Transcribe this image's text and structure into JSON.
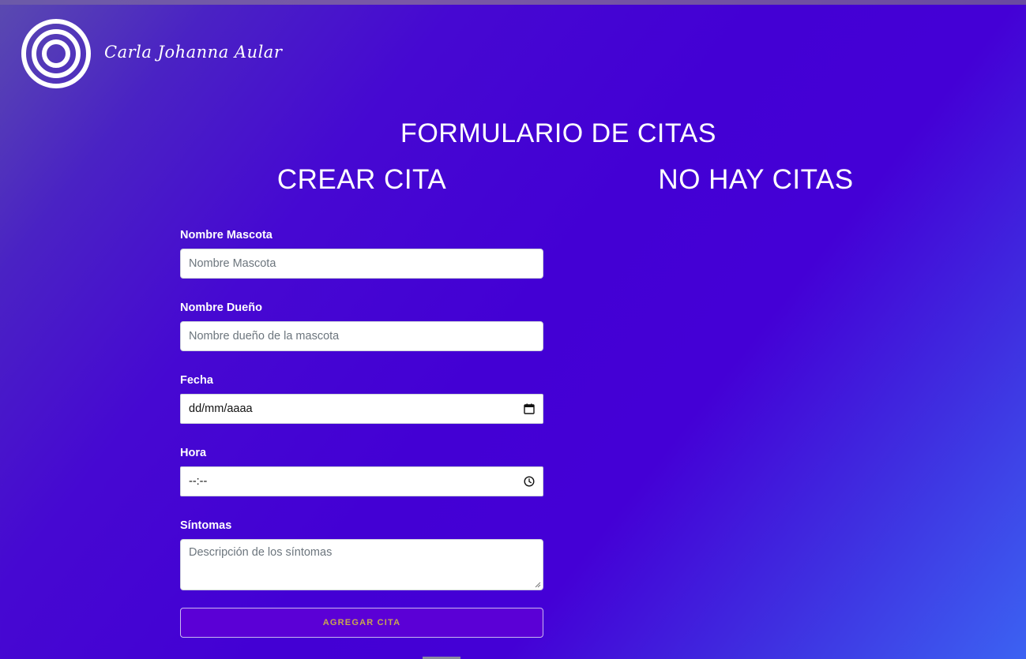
{
  "header": {
    "brand_name": "Carla Johanna Aular",
    "logo_icon": "concentric-circles-logo"
  },
  "page": {
    "title": "FORMULARIO DE CITAS",
    "create_heading": "CREAR CITA",
    "appointments_heading": "NO HAY CITAS"
  },
  "form": {
    "pet_name": {
      "label": "Nombre Mascota",
      "placeholder": "Nombre Mascota"
    },
    "owner_name": {
      "label": "Nombre Dueño",
      "placeholder": "Nombre dueño de la mascota"
    },
    "date": {
      "label": "Fecha",
      "value": "dd/mm/aaaa",
      "icon": "calendar-icon"
    },
    "time": {
      "label": "Hora",
      "value": "--:--",
      "icon": "clock-icon"
    },
    "symptoms": {
      "label": "Síntomas",
      "placeholder": "Descripción de los síntomas"
    },
    "submit_label": "AGREGAR CITA"
  },
  "colors": {
    "background_start": "#5a4ab0",
    "background_mid": "#4300d4",
    "background_end": "#3c62f2",
    "button_bg": "#5b00d6",
    "button_text": "#c8a850"
  }
}
